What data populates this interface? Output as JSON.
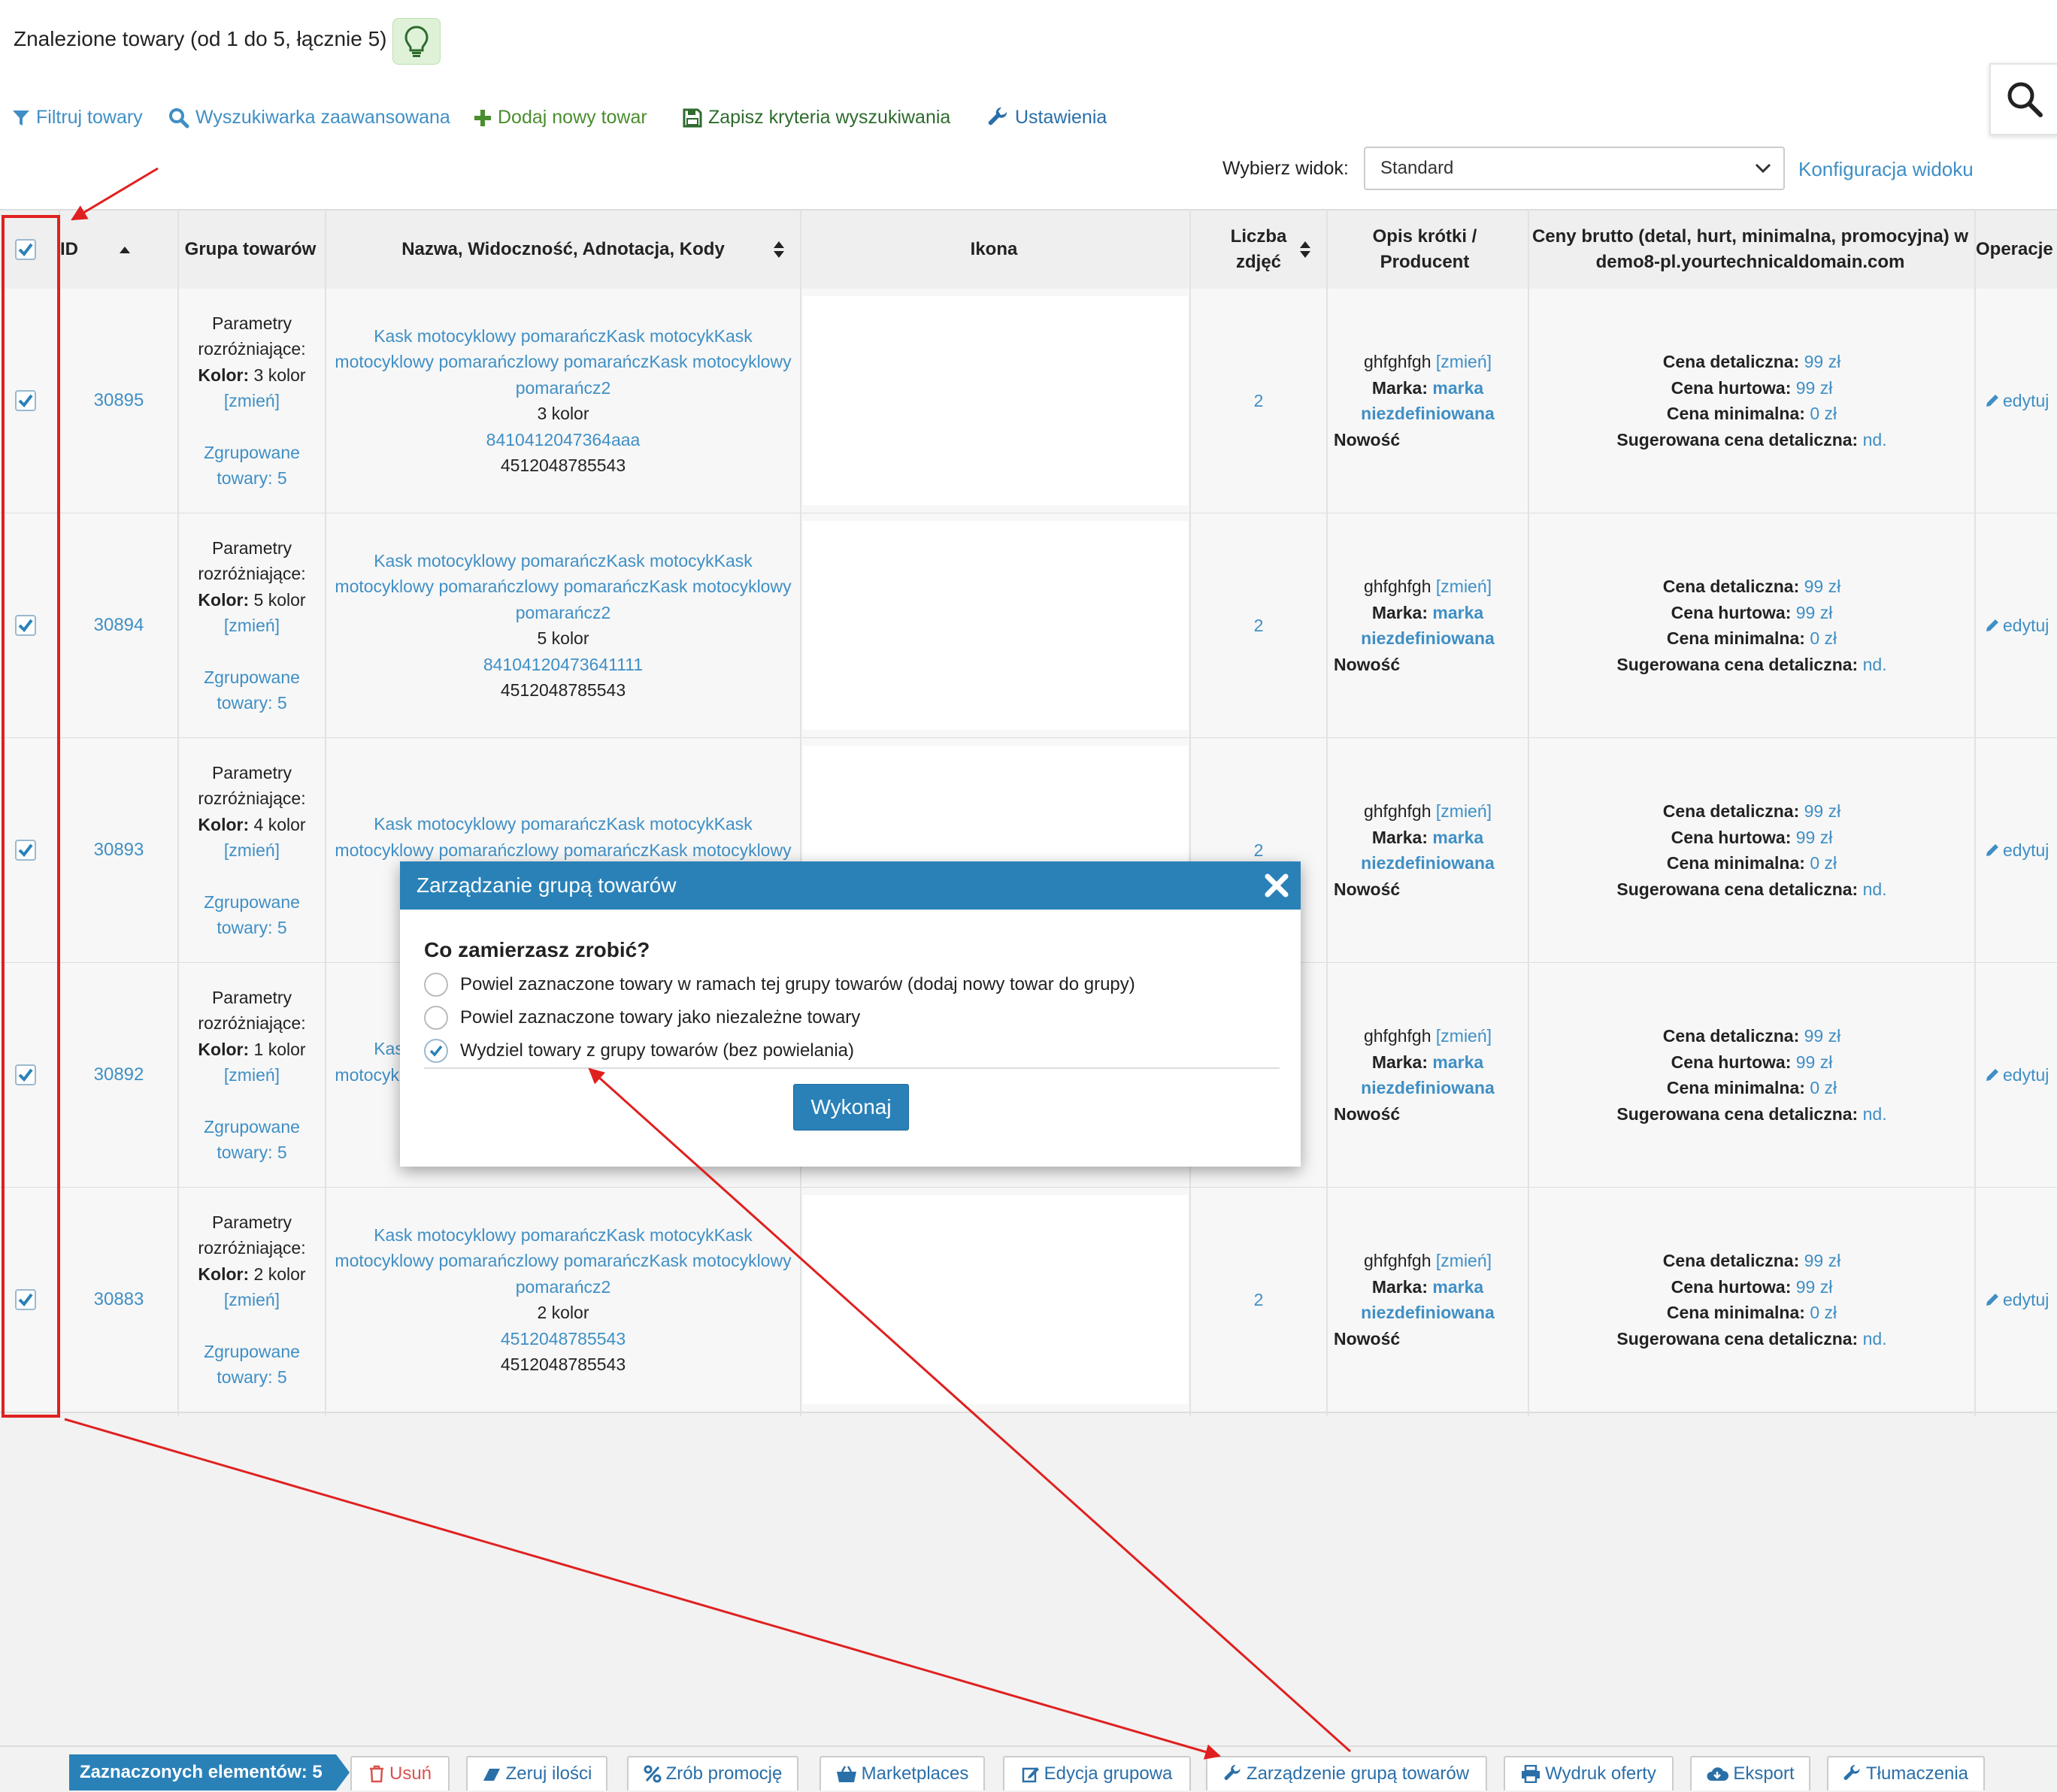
{
  "page": {
    "title": "Znalezione towary (od 1 do 5, łącznie 5)"
  },
  "toolbar": {
    "filter": "Filtruj towary",
    "advanced_search": "Wyszukiwarka zaawansowana",
    "add_new": "Dodaj nowy towar",
    "save_criteria": "Zapisz kryteria wyszukiwania",
    "settings": "Ustawienia"
  },
  "view": {
    "label": "Wybierz widok:",
    "selected": "Standard",
    "config_link": "Konfiguracja widoku"
  },
  "table": {
    "headers": {
      "id": "ID",
      "group": "Grupa towarów",
      "name": "Nazwa, Widoczność, Adnotacja, Kody",
      "icon": "Ikona",
      "photos_1": "Liczba",
      "photos_2": "zdjęć",
      "desc_1": "Opis krótki /",
      "desc_2": "Producent",
      "prices_1": "Ceny brutto (detal, hurt, minimalna, promocyjna) w",
      "prices_2": "demo8-pl.yourtechnicaldomain.com",
      "ops": "Operacje"
    },
    "common": {
      "param_1": "Parametry",
      "param_2": "rozróżniające:",
      "kolor_label": "Kolor:",
      "zmien": "[zmień]",
      "grouped_1": "Zgrupowane",
      "grouped_2": "towary: 5",
      "name_1": "Kask motocyklowy pomarańczKask motocykKask",
      "name_2": "motocyklowy pomarańczlowy pomarańczKask motocyklowy",
      "name_3": "pomarańcz2",
      "short_desc": "ghfghfgh",
      "desc_zmien": "[zmień]",
      "brand_label": "Marka:",
      "brand_1": "marka",
      "brand_2": "niezdefiniowana",
      "badge": "Nowość",
      "price_retail_label": "Cena detaliczna:",
      "price_retail": "99 zł",
      "price_wholesale_label": "Cena hurtowa:",
      "price_wholesale": "99 zł",
      "price_min_label": "Cena minimalna:",
      "price_min": "0 zł",
      "price_sugg_label": "Sugerowana cena detaliczna:",
      "price_sugg": "nd.",
      "edit": "edytuj"
    },
    "rows": [
      {
        "id": "30895",
        "color": "3 kolor",
        "variant": "3 kolor",
        "code_link": "8410412047364aaa",
        "code": "4512048785543",
        "photos": "2"
      },
      {
        "id": "30894",
        "color": "5 kolor",
        "variant": "5 kolor",
        "code_link": "84104120473641111",
        "code": "4512048785543",
        "photos": "2"
      },
      {
        "id": "30893",
        "color": "4 kolor",
        "variant": "",
        "code_link": "",
        "code": "",
        "photos": "2"
      },
      {
        "id": "30892",
        "color": "1 kolor",
        "variant": "",
        "code_link": "",
        "code": "",
        "photos": ""
      },
      {
        "id": "30883",
        "color": "2 kolor",
        "variant": "2 kolor",
        "code_link": "4512048785543",
        "code": "4512048785543",
        "photos": "2"
      }
    ]
  },
  "modal": {
    "title": "Zarządzanie grupą towarów",
    "question": "Co zamierzasz zrobić?",
    "options": [
      {
        "label": "Powiel zaznaczone towary w ramach tej grupy towarów (dodaj nowy towar do grupy)",
        "checked": false
      },
      {
        "label": "Powiel zaznaczone towary jako niezależne towary",
        "checked": false
      },
      {
        "label": "Wydziel towary z grupy towarów (bez powielania)",
        "checked": true
      }
    ],
    "run": "Wykonaj",
    "close_icon": "close-icon"
  },
  "bottom_bar": {
    "selected_count": "Zaznaczonych elementów: 5",
    "delete": "Usuń",
    "zero_qty": "Zeruj ilości",
    "promo": "Zrób promocję",
    "marketplaces": "Marketplaces",
    "bulk_edit": "Edycja grupowa",
    "group_mgmt": "Zarządzenie grupą towarów",
    "print_offer": "Wydruk oferty",
    "export": "Eksport",
    "translations": "Tłumaczenia"
  },
  "colors": {
    "accent": "#2a81b8",
    "link": "#3f8fc5",
    "add": "#4a8d2e",
    "danger": "#d9534f",
    "annotation": "#e02020"
  }
}
